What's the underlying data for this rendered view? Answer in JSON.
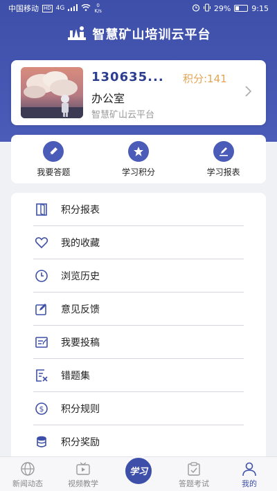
{
  "status_bar": {
    "carrier": "中国移动",
    "hd_badge": "HD",
    "network": "4G",
    "speed_value": "0",
    "speed_unit": "K/s",
    "battery": "29%",
    "time": "9:15"
  },
  "header": {
    "title": "智慧矿山培训云平台"
  },
  "profile": {
    "username": "130635...",
    "points": "积分:141",
    "department": "办公室",
    "organization": "智慧矿山云平台"
  },
  "quick_actions": [
    {
      "label": "我要答题",
      "icon": "pencil-icon"
    },
    {
      "label": "学习积分",
      "icon": "star-icon"
    },
    {
      "label": "学习报表",
      "icon": "edit-icon"
    }
  ],
  "menu": [
    {
      "label": "积分报表",
      "icon": "door-icon"
    },
    {
      "label": "我的收藏",
      "icon": "heart-icon"
    },
    {
      "label": "浏览历史",
      "icon": "clock-icon"
    },
    {
      "label": "意见反馈",
      "icon": "feedback-icon"
    },
    {
      "label": "我要投稿",
      "icon": "submit-icon"
    },
    {
      "label": "错题集",
      "icon": "wrong-questions-icon"
    },
    {
      "label": "积分规则",
      "icon": "dollar-icon"
    },
    {
      "label": "积分奖励",
      "icon": "coin-stack-icon"
    }
  ],
  "tabbar": [
    {
      "label": "新闻动态",
      "icon": "globe-icon"
    },
    {
      "label": "视频教学",
      "icon": "tv-icon"
    },
    {
      "label": "学习",
      "icon": "study-icon"
    },
    {
      "label": "答题考试",
      "icon": "exam-icon"
    },
    {
      "label": "我的",
      "icon": "person-icon"
    }
  ],
  "colors": {
    "primary": "#3d4fa8",
    "accent_points": "#e3a457",
    "background": "#f0f1f5"
  }
}
